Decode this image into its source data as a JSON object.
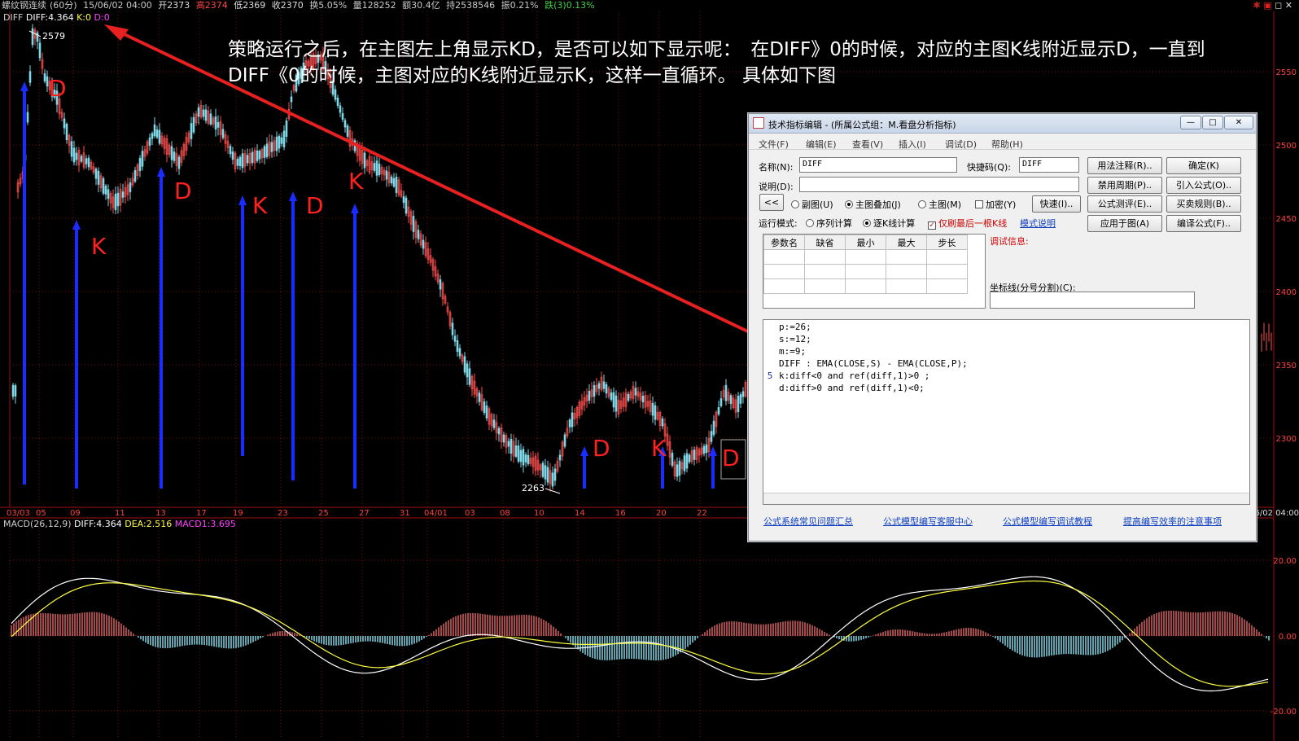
{
  "header": {
    "symbol": "螺纹钢连续",
    "period": "(60分)",
    "datetime": "15/06/02 04:00",
    "open": "开2373",
    "high": "高2374",
    "low": "低2369",
    "close": "收2370",
    "turnover": "换5.05%",
    "volume": "量128252",
    "amount": "额30.4亿",
    "oi": "持2538546",
    "amp": "振0.21%",
    "change": "跌(3)0.13%"
  },
  "indicator": {
    "name": "DIFF",
    "diff": "DIFF:4.364",
    "k": "K:0",
    "d": "D:0"
  },
  "price_axis": [
    "2550",
    "2500",
    "2450",
    "2400",
    "2350",
    "2300"
  ],
  "macd_axis": [
    "20.00",
    "0.00",
    "-20.00"
  ],
  "date_axis": [
    "03/03",
    "05",
    "09",
    "11",
    "13",
    "17",
    "19",
    "23",
    "25",
    "27",
    "31",
    "04/01",
    "03",
    "08",
    "10",
    "14",
    "16",
    "20",
    "22"
  ],
  "date_right": "6/02 04:00",
  "price_marks": {
    "high": "2579",
    "low": "2263"
  },
  "markers": [
    "D",
    "K",
    "D",
    "K",
    "D",
    "K",
    "D",
    "K",
    "D"
  ],
  "note": "策略运行之后，在主图左上角显示KD，是否可以如下显示呢：　在DIFF》0的时候，对应的主图K线附近显示D，一直到DIFF《0的时候，主图对应的K线附近显示K，这样一直循环。 具体如下图",
  "macd": {
    "name": "MACD(26,12,9)",
    "diff": "DIFF:4.364",
    "dea": "DEA:2.516",
    "macd1": "MACD1:3.695"
  },
  "dialog": {
    "title": "技术指标编辑 - (所属公式组：M.看盘分析指标)",
    "menu": [
      "文件(F)",
      "编辑(E)",
      "查看(V)",
      "插入(I)",
      "调试(D)",
      "帮助(H)"
    ],
    "name_label": "名称(N):",
    "name_value": "DIFF",
    "shortcut_label": "快捷码(Q):",
    "shortcut_value": "DIFF",
    "desc_label": "说明(D):",
    "desc_value": "",
    "collapse": "<<",
    "radio_sub": "副图(U)",
    "radio_overlay": "主图叠加(J)",
    "radio_main": "主图(M)",
    "check_encrypt": "加密(Y)",
    "run_label": "运行模式:",
    "run_seq": "序列计算",
    "run_bar": "逐K线计算",
    "run_last": "仅刷最后一根K线",
    "mode_help": "模式说明",
    "grid_headers": [
      "参数名",
      "缺省",
      "最小",
      "最大",
      "步长"
    ],
    "debug_label": "调试信息:",
    "coord_label": "坐标线(分号分割)(C):",
    "buttons": {
      "usage": "用法注释(R)..",
      "ok": "确定(K)",
      "forbid": "禁用周期(P)..",
      "import": "引入公式(O)..",
      "quick": "快速(I)..",
      "test": "公式测评(E)..",
      "rule": "买卖规则(B)..",
      "apply": "应用于图(A)",
      "compile": "编译公式(F).."
    },
    "code": [
      "p:=26;",
      "s:=12;",
      "m:=9;",
      "DIFF : EMA(CLOSE,S) - EMA(CLOSE,P);",
      "k:diff<0 and ref(diff,1)>0 ;",
      "d:diff>0 and ref(diff,1)<0;"
    ],
    "line_num": "5",
    "links": [
      "公式系统常见问题汇总",
      "公式模型编写客服中心",
      "公式模型编写调试教程",
      "提高编写效率的注意事项"
    ]
  }
}
